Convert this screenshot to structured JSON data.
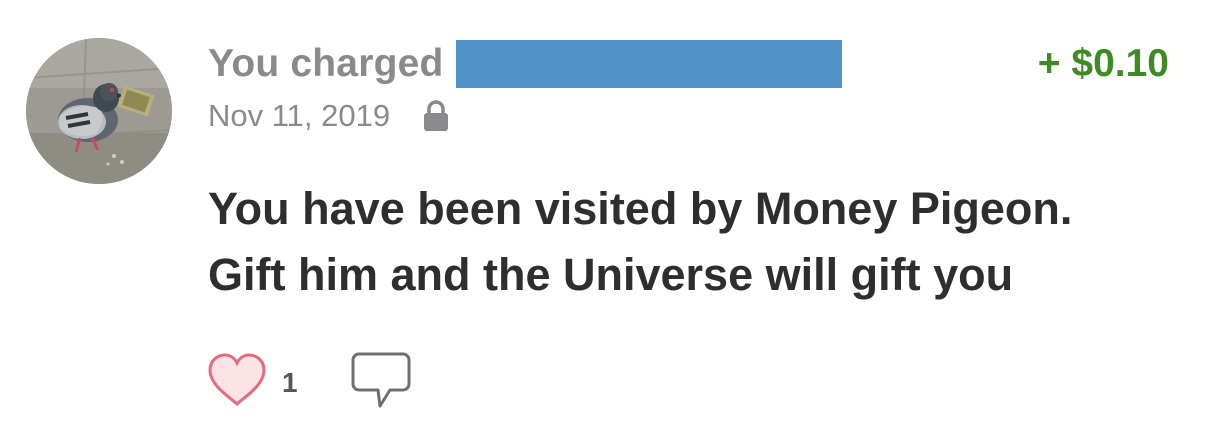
{
  "story": {
    "title_prefix": "You charged",
    "amount": "+ $0.10",
    "date": "Nov 11, 2019",
    "privacy_icon": "lock-icon",
    "message_lines": [
      "You have been visited by Money Pigeon.",
      "Gift him and the Universe will gift you"
    ]
  },
  "actions": {
    "like_icon": "heart-icon",
    "like_count": "1",
    "comment_icon": "comment-icon"
  },
  "colors": {
    "amount_positive": "#3e8a23",
    "redaction": "#5293c9",
    "like_heart": "#e36b7b",
    "muted_text": "#8a8a8e"
  }
}
